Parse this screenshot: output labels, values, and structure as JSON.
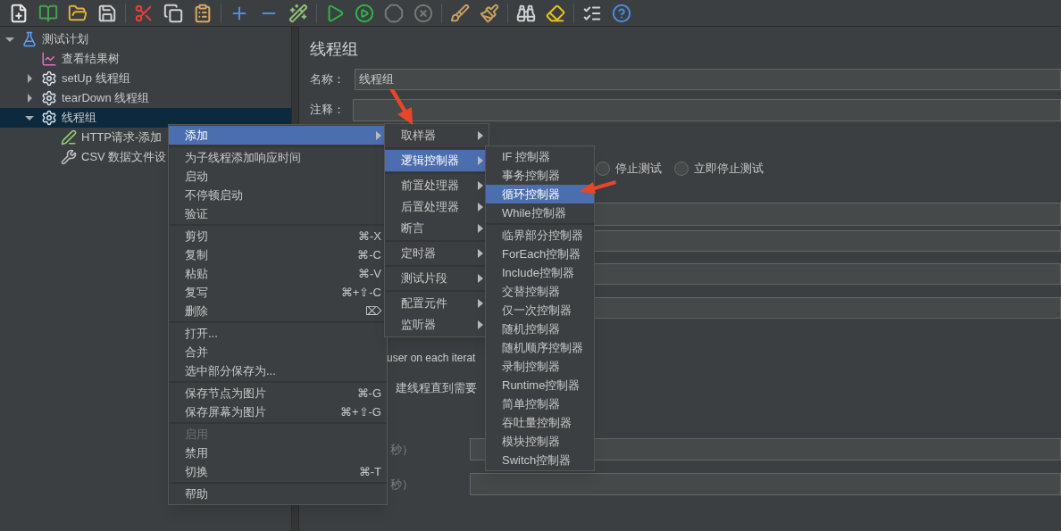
{
  "toolbar": [
    {
      "kind": "new"
    },
    {
      "kind": "templates"
    },
    {
      "kind": "open"
    },
    {
      "kind": "save"
    },
    {
      "kind": "cut"
    },
    {
      "kind": "copy"
    },
    {
      "kind": "paste"
    },
    {
      "kind": "add"
    },
    {
      "kind": "remove"
    },
    {
      "kind": "toggle"
    },
    {
      "kind": "start"
    },
    {
      "kind": "start-no-timers"
    },
    {
      "kind": "stop"
    },
    {
      "kind": "shutdown"
    },
    {
      "kind": "clear"
    },
    {
      "kind": "clear-all"
    },
    {
      "kind": "search"
    },
    {
      "kind": "reset-search"
    },
    {
      "kind": "function-helper"
    },
    {
      "kind": "help"
    }
  ],
  "tree": [
    {
      "label": "测试计划",
      "kind": "plan",
      "expanded": true,
      "selected": false,
      "children": [
        {
          "label": "查看结果树",
          "kind": "listener",
          "selected": false
        },
        {
          "label": "setUp 线程组",
          "kind": "thread-group",
          "expanded": false,
          "selected": false
        },
        {
          "label": "tearDown 线程组",
          "kind": "thread-group",
          "expanded": false,
          "selected": false
        },
        {
          "label": "线程组",
          "kind": "thread-group",
          "expanded": true,
          "selected": true,
          "children": [
            {
              "label": "HTTP请求-添加",
              "kind": "sampler",
              "selected": false
            },
            {
              "label": "CSV 数据文件设",
              "kind": "config",
              "selected": false
            }
          ]
        }
      ]
    }
  ],
  "editor": {
    "title": "线程组",
    "name_label": "名称：",
    "name_value": "线程组",
    "comment_label": "注释：",
    "radios": [
      {
        "label": "停止测试",
        "selected": false
      },
      {
        "label": "立即停止测试",
        "selected": false
      }
    ],
    "texts": [
      "user on each iterat",
      "建线程直到需要"
    ],
    "duration_labels": [
      "秒）",
      "秒）"
    ]
  },
  "context_menu": {
    "groups": [
      [
        {
          "label": "添加",
          "submenu": true,
          "selected": true,
          "disabled": false
        }
      ],
      [
        {
          "label": "为子线程添加响应时间",
          "submenu": false,
          "selected": false,
          "disabled": false
        },
        {
          "label": "启动",
          "submenu": false,
          "selected": false,
          "disabled": false
        },
        {
          "label": "不停顿启动",
          "submenu": false,
          "selected": false,
          "disabled": false
        },
        {
          "label": "验证",
          "submenu": false,
          "selected": false,
          "disabled": false
        }
      ],
      [
        {
          "label": "剪切",
          "shortcut": "⌘-X",
          "submenu": false,
          "selected": false,
          "disabled": false
        },
        {
          "label": "复制",
          "shortcut": "⌘-C",
          "submenu": false,
          "selected": false,
          "disabled": false
        },
        {
          "label": "粘贴",
          "shortcut": "⌘-V",
          "submenu": false,
          "selected": false,
          "disabled": false
        },
        {
          "label": "复写",
          "shortcut": "⌘+⇧-C",
          "submenu": false,
          "selected": false,
          "disabled": false
        },
        {
          "label": "删除",
          "shortcut": "⌦",
          "submenu": false,
          "selected": false,
          "disabled": false
        }
      ],
      [
        {
          "label": "打开...",
          "submenu": false,
          "selected": false,
          "disabled": false
        },
        {
          "label": "合并",
          "submenu": false,
          "selected": false,
          "disabled": false
        },
        {
          "label": "选中部分保存为...",
          "submenu": false,
          "selected": false,
          "disabled": false
        }
      ],
      [
        {
          "label": "保存节点为图片",
          "shortcut": "⌘-G",
          "submenu": false,
          "selected": false,
          "disabled": false
        },
        {
          "label": "保存屏幕为图片",
          "shortcut": "⌘+⇧-G",
          "submenu": false,
          "selected": false,
          "disabled": false
        }
      ],
      [
        {
          "label": "启用",
          "submenu": false,
          "selected": false,
          "disabled": true
        },
        {
          "label": "禁用",
          "submenu": false,
          "selected": false,
          "disabled": false
        },
        {
          "label": "切换",
          "shortcut": "⌘-T",
          "submenu": false,
          "selected": false,
          "disabled": false
        }
      ],
      [
        {
          "label": "帮助",
          "submenu": false,
          "selected": false,
          "disabled": false
        }
      ]
    ]
  },
  "add_submenu": {
    "groups": [
      [
        {
          "label": "取样器",
          "selected": false
        }
      ],
      [
        {
          "label": "逻辑控制器",
          "selected": true
        }
      ],
      [
        {
          "label": "前置处理器",
          "selected": false
        },
        {
          "label": "后置处理器",
          "selected": false
        },
        {
          "label": "断言",
          "selected": false
        }
      ],
      [
        {
          "label": "定时器",
          "selected": false
        }
      ],
      [
        {
          "label": "测试片段",
          "selected": false
        }
      ],
      [
        {
          "label": "配置元件",
          "selected": false
        },
        {
          "label": "监听器",
          "selected": false
        }
      ]
    ]
  },
  "controller_submenu": {
    "groups": [
      [
        {
          "label": "IF 控制器",
          "selected": false
        },
        {
          "label": "事务控制器",
          "selected": false
        },
        {
          "label": "循环控制器",
          "selected": true
        },
        {
          "label": "While控制器",
          "selected": false
        }
      ],
      [
        {
          "label": "临界部分控制器",
          "selected": false
        },
        {
          "label": "ForEach控制器",
          "selected": false
        },
        {
          "label": "Include控制器",
          "selected": false
        },
        {
          "label": "交替控制器",
          "selected": false
        },
        {
          "label": "仅一次控制器",
          "selected": false
        },
        {
          "label": "随机控制器",
          "selected": false
        },
        {
          "label": "随机顺序控制器",
          "selected": false
        },
        {
          "label": "录制控制器",
          "selected": false
        },
        {
          "label": "Runtime控制器",
          "selected": false
        },
        {
          "label": "简单控制器",
          "selected": false
        },
        {
          "label": "吞吐量控制器",
          "selected": false
        },
        {
          "label": "模块控制器",
          "selected": false
        },
        {
          "label": "Switch控制器",
          "selected": false
        }
      ]
    ]
  }
}
